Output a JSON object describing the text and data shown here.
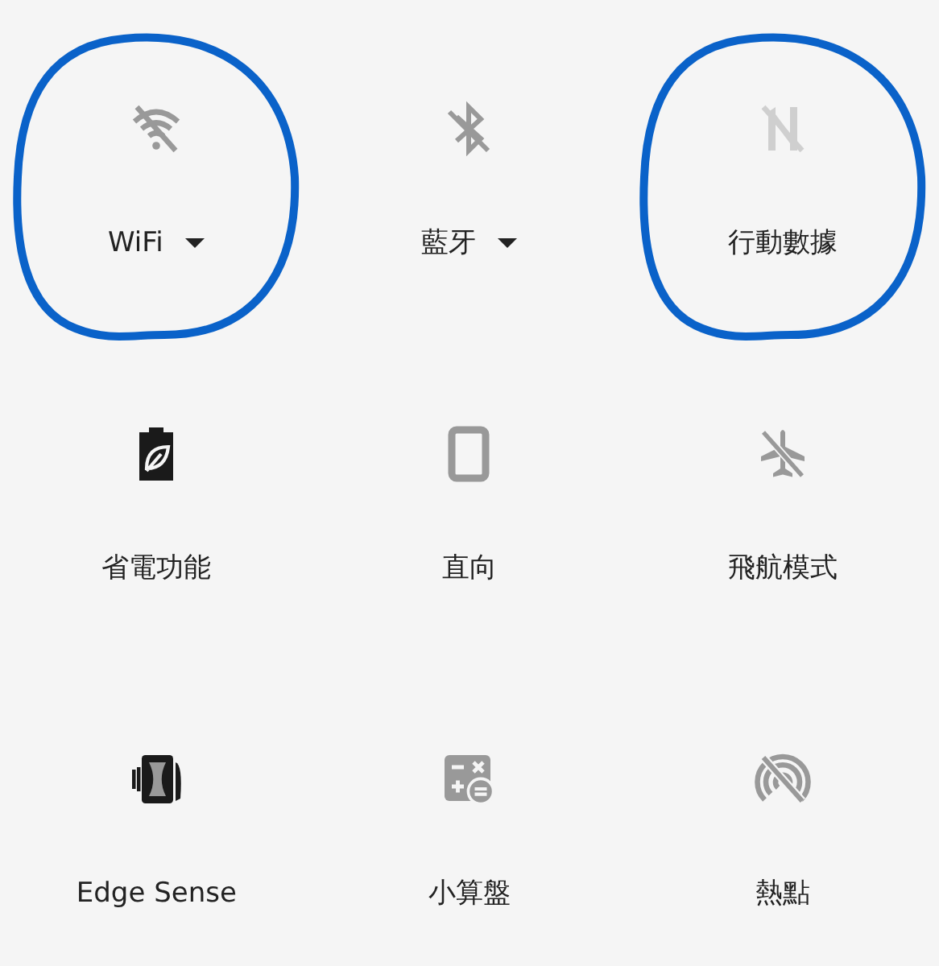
{
  "tiles": [
    {
      "kind": "wifi",
      "label": "WiFi",
      "on": false,
      "disabled": false,
      "dropdown": true,
      "circled": true
    },
    {
      "kind": "bluetooth",
      "label": "藍牙",
      "on": false,
      "disabled": false,
      "dropdown": true,
      "circled": false
    },
    {
      "kind": "mobile-data",
      "label": "行動數據",
      "on": false,
      "disabled": true,
      "dropdown": false,
      "circled": true
    },
    {
      "kind": "battery-saver",
      "label": "省電功能",
      "on": true,
      "disabled": false,
      "dropdown": false,
      "circled": false
    },
    {
      "kind": "rotation",
      "label": "直向",
      "on": false,
      "disabled": false,
      "dropdown": false,
      "circled": false
    },
    {
      "kind": "airplane",
      "label": "飛航模式",
      "on": false,
      "disabled": false,
      "dropdown": false,
      "circled": false
    },
    {
      "kind": "edge-sense",
      "label": "Edge Sense",
      "on": true,
      "disabled": false,
      "dropdown": false,
      "circled": false
    },
    {
      "kind": "calculator",
      "label": "小算盤",
      "on": false,
      "disabled": false,
      "dropdown": false,
      "circled": false
    },
    {
      "kind": "hotspot",
      "label": "熱點",
      "on": false,
      "disabled": false,
      "dropdown": false,
      "circled": false
    }
  ]
}
